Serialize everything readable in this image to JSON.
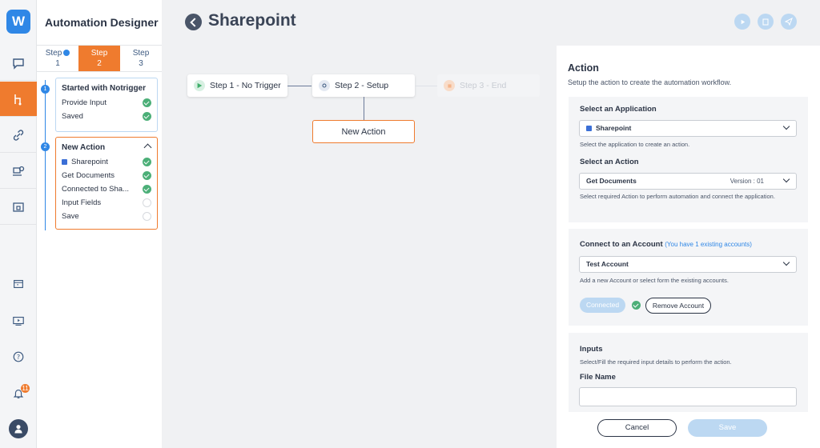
{
  "app": {
    "logo_letter": "W",
    "title": "Automation Designer",
    "notification_count": "11"
  },
  "steps": [
    {
      "label": "Step",
      "num": "1"
    },
    {
      "label": "Step",
      "num": "2"
    },
    {
      "label": "Step",
      "num": "3"
    }
  ],
  "trigger_box": {
    "index": "1",
    "title": "Started with Notrigger",
    "items": [
      "Provide Input",
      "Saved"
    ]
  },
  "action_box": {
    "index": "2",
    "title": "New Action",
    "items": [
      "Sharepoint",
      "Get Documents",
      "Connected to Sha...",
      "Input Fields",
      "Save"
    ]
  },
  "canvas": {
    "page_title": "Sharepoint",
    "nodes": {
      "step1": "Step 1 - No Trigger",
      "step2": "Step 2 - Setup",
      "step3": "Step 3 - End"
    },
    "new_action": "New Action"
  },
  "action_panel": {
    "title": "Action",
    "subtitle": "Setup the action to create the automation workflow.",
    "select_app_label": "Select an Application",
    "app_value": "Sharepoint",
    "app_hint": "Select the application to create an action.",
    "select_action_label": "Select an Action",
    "action_value": "Get Documents",
    "action_version": "Version : 01",
    "action_hint": "Select required Action to perform automation and connect the application.",
    "account_label": "Connect to an Account",
    "account_extra": "(You have 1 existing accounts)",
    "account_value": "Test Account",
    "account_hint": "Add a new Account or select form the existing accounts.",
    "connected_label": "Connected",
    "remove_label": "Remove Account",
    "inputs_label": "Inputs",
    "inputs_hint": "Select/Fill the required input details to perform the action.",
    "file_name_label": "File Name",
    "cancel_label": "Cancel",
    "save_label": "Save"
  },
  "colors": {
    "accent": "#ef7b2e",
    "primary": "#2f87e6",
    "success": "#4caf78",
    "disabled": "#bcd8f2"
  }
}
